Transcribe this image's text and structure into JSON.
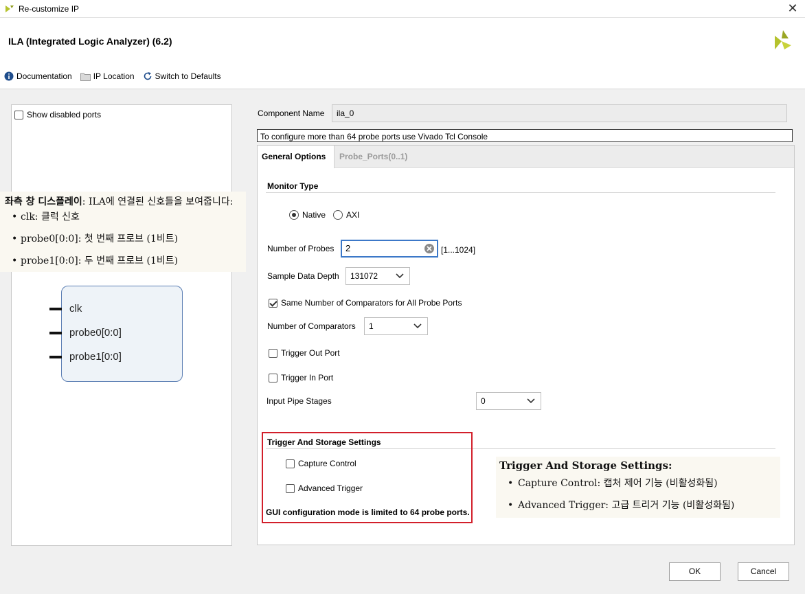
{
  "window": {
    "title": "Re-customize IP"
  },
  "header": {
    "ip_title": "ILA (Integrated Logic Analyzer) (6.2)"
  },
  "toolbar": {
    "documentation": "Documentation",
    "ip_location": "IP Location",
    "switch_defaults": "Switch to Defaults"
  },
  "left": {
    "show_disabled_label": "Show disabled ports",
    "show_disabled_checked": false,
    "ports": [
      "clk",
      "probe0[0:0]",
      "probe1[0:0]"
    ]
  },
  "annotation_left": {
    "title_bold": "좌측 창 디스플레이",
    "title_rest": ": ILA에 연결된 신호들을 보여줍니다:",
    "items": [
      "clk: 클럭 신호",
      "probe0[0:0]: 첫 번째 프로브 (1비트)",
      "probe1[0:0]: 두 번째 프로브 (1비트)"
    ]
  },
  "component": {
    "label": "Component Name",
    "value": "ila_0",
    "info": "To configure more than 64 probe ports use Vivado Tcl Console"
  },
  "tabs": [
    {
      "label": "General Options",
      "active": true
    },
    {
      "label": "Probe_Ports(0..1)",
      "active": false
    }
  ],
  "general": {
    "monitor_type_title": "Monitor Type",
    "monitor_options": [
      "Native",
      "AXI"
    ],
    "monitor_selected": "Native",
    "num_probes_label": "Number of Probes",
    "num_probes_value": "2",
    "num_probes_range": "[1...1024]",
    "sample_depth_label": "Sample Data Depth",
    "sample_depth_value": "131072",
    "same_comparators_label": "Same Number of Comparators for All Probe Ports",
    "same_comparators_checked": true,
    "num_comparators_label": "Number of Comparators",
    "num_comparators_value": "1",
    "trigger_out_label": "Trigger Out Port",
    "trigger_in_label": "Trigger In Port",
    "pipe_stages_label": "Input Pipe Stages",
    "pipe_stages_value": "0",
    "trigger_storage_title": "Trigger And Storage Settings",
    "capture_control_label": "Capture Control",
    "advanced_trigger_label": "Advanced Trigger",
    "warning": "GUI configuration mode is limited to 64 probe ports."
  },
  "annotation_right": {
    "title": "Trigger And Storage Settings:",
    "items": [
      "Capture Control: 캡처 제어 기능 (비활성화됨)",
      "Advanced Trigger: 고급 트리거 기능 (비활성화됨)"
    ]
  },
  "buttons": {
    "ok": "OK",
    "cancel": "Cancel"
  },
  "colors": {
    "accent": "#3c78c8",
    "highlight_border": "#d21f2b",
    "logo": "#b5c22d"
  }
}
